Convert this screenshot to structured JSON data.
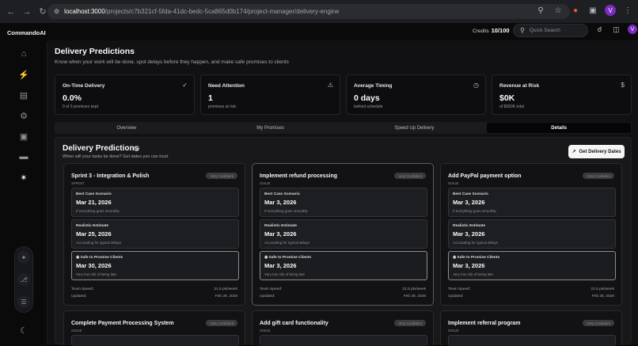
{
  "browser": {
    "url_host": "localhost:3000",
    "url_path": "/projects/c7b321cf-5fda-41dc-bedc-5ca865d0b174/project-manager/delivery-engine",
    "profile_initial": "V"
  },
  "app": {
    "brand": "CommandoAI",
    "credits_label": "Credits",
    "credits_value": "10/100",
    "search_placeholder": "Quick Search",
    "user_initial": "V"
  },
  "page": {
    "title": "Delivery Predictions",
    "subtitle": "Know when your work will be done, spot delays before they happen, and make safe promises to clients"
  },
  "stats": [
    {
      "label": "On-Time Delivery",
      "value": "0.0%",
      "note": "0 of 3 promises kept",
      "icon": "check-circle-icon"
    },
    {
      "label": "Need Attention",
      "value": "1",
      "note": "promises at risk",
      "icon": "warning-icon"
    },
    {
      "label": "Average Timing",
      "value": "0 days",
      "note": "behind schedule",
      "icon": "clock-icon"
    },
    {
      "label": "Revenue at Risk",
      "value": "$0K",
      "note": "of $650K total",
      "icon": "dollar-icon"
    }
  ],
  "tabs": [
    {
      "label": "Overview",
      "active": false
    },
    {
      "label": "My Promises",
      "active": false
    },
    {
      "label": "Speed Up Delivery",
      "active": false
    },
    {
      "label": "Details",
      "active": true
    }
  ],
  "section": {
    "title": "Delivery Predictions",
    "subtitle": "When will your tasks be done? Get dates you can trust.",
    "button_label": "Get Delivery Dates"
  },
  "scenario_labels": {
    "best": "Best Case Scenario",
    "realistic": "Realistic Estimate",
    "safe": "Safe to Promise Clients"
  },
  "scenario_notes": {
    "best": "If everything goes smoothly",
    "realistic": "Accounting for typical delays",
    "safe": "Very low risk of being late"
  },
  "footer_labels": {
    "speed": "Team Speed:",
    "updated": "Updated:"
  },
  "cards": [
    {
      "title": "Sprint 3 - Integration & Polish",
      "type": "SPRINT",
      "badge": "Very Confident",
      "best": "Mar 21, 2026",
      "realistic": "Mar 25, 2026",
      "safe": "Mar 30, 2026",
      "speed": "21.5 pts/week",
      "updated": "Feb 28, 2026"
    },
    {
      "title": "Implement refund processing",
      "type": "ISSUE",
      "badge": "Very Confident",
      "best": "Mar 3, 2026",
      "realistic": "Mar 3, 2026",
      "safe": "Mar 3, 2026",
      "speed": "21.5 pts/week",
      "updated": "Feb 28, 2026"
    },
    {
      "title": "Add PayPal payment option",
      "type": "ISSUE",
      "badge": "Very Confident",
      "best": "Mar 3, 2026",
      "realistic": "Mar 3, 2026",
      "safe": "Mar 3, 2026",
      "speed": "21.5 pts/week",
      "updated": "Feb 28, 2026"
    },
    {
      "title": "Complete Payment Processing System",
      "type": "ISSUE",
      "badge": "Very Confident"
    },
    {
      "title": "Add gift card functionality",
      "type": "ISSUE",
      "badge": "Very Confident"
    },
    {
      "title": "Implement referral program",
      "type": "ISSUE",
      "badge": "Very Confident"
    }
  ]
}
